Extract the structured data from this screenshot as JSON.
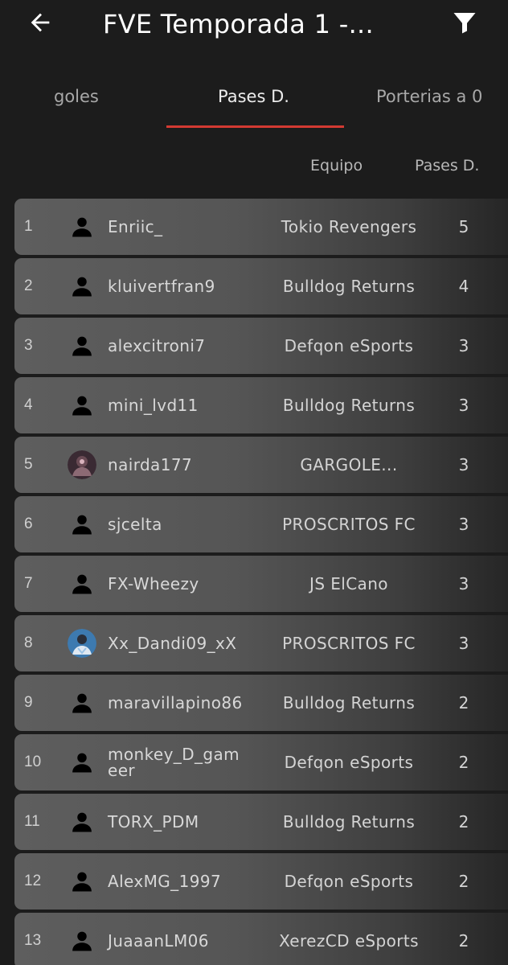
{
  "header": {
    "title": "FVE Temporada 1 -...",
    "back_icon": "arrow-left-icon",
    "filter_icon": "filter-icon"
  },
  "tabs": [
    {
      "label": "goles",
      "active": false
    },
    {
      "label": "Pases D.",
      "active": true
    },
    {
      "label": "Porterias a 0",
      "active": false
    }
  ],
  "columns": {
    "team": "Equipo",
    "stat": "Pases D."
  },
  "colors": {
    "accent": "#d33a32",
    "background": "#1c1c1c"
  },
  "rows": [
    {
      "rank": "1",
      "player": "Enriic_",
      "team": "Tokio Revengers",
      "value": "5",
      "avatar": "person-icon"
    },
    {
      "rank": "2",
      "player": "kluivertfran9",
      "team": "Bulldog Returns",
      "value": "4",
      "avatar": "person-icon"
    },
    {
      "rank": "3",
      "player": "alexcitroni7",
      "team": "Defqon eSports",
      "value": "3",
      "avatar": "person-icon"
    },
    {
      "rank": "4",
      "player": "mini_lvd11",
      "team": "Bulldog Returns",
      "value": "3",
      "avatar": "person-icon"
    },
    {
      "rank": "5",
      "player": "nairda177",
      "team": "GARGOLE...",
      "value": "3",
      "avatar": "user-photo"
    },
    {
      "rank": "6",
      "player": "sjcelta",
      "team": "PROSCRITOS FC",
      "value": "3",
      "avatar": "person-icon"
    },
    {
      "rank": "7",
      "player": "FX-Wheezy",
      "team": "JS ElCano",
      "value": "3",
      "avatar": "person-icon"
    },
    {
      "rank": "8",
      "player": "Xx_Dandi09_xX",
      "team": "PROSCRITOS FC",
      "value": "3",
      "avatar": "user-photo"
    },
    {
      "rank": "9",
      "player": "maravillapino86",
      "team": "Bulldog Returns",
      "value": "2",
      "avatar": "person-icon"
    },
    {
      "rank": "10",
      "player": "monkey_D_gameer",
      "team": "Defqon eSports",
      "value": "2",
      "avatar": "person-icon"
    },
    {
      "rank": "11",
      "player": "TORX_PDM",
      "team": "Bulldog Returns",
      "value": "2",
      "avatar": "person-icon"
    },
    {
      "rank": "12",
      "player": "AlexMG_1997",
      "team": "Defqon eSports",
      "value": "2",
      "avatar": "person-icon"
    },
    {
      "rank": "13",
      "player": "JuaaanLM06",
      "team": "XerezCD eSports",
      "value": "2",
      "avatar": "person-icon"
    }
  ]
}
